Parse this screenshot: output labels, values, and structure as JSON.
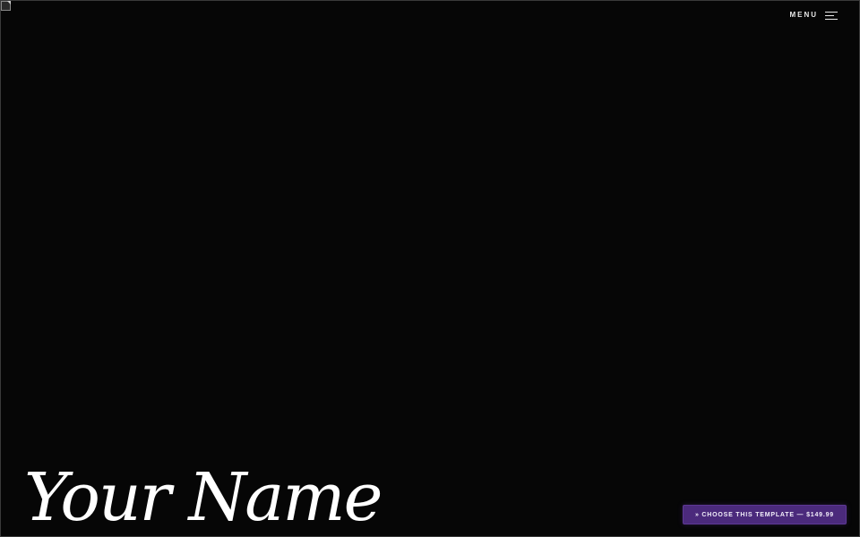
{
  "header": {
    "menu_label": "MENU",
    "menu_icon": "hamburger-icon"
  },
  "hero": {
    "name": "Your Name",
    "background_image_icon": "broken-image-icon"
  },
  "cta": {
    "label": "» CHOOSE THIS TEMPLATE — $149.99",
    "color": "#4b2a7c"
  },
  "colors": {
    "background": "#060606",
    "text": "#ffffff",
    "accent": "#4b2a7c"
  }
}
